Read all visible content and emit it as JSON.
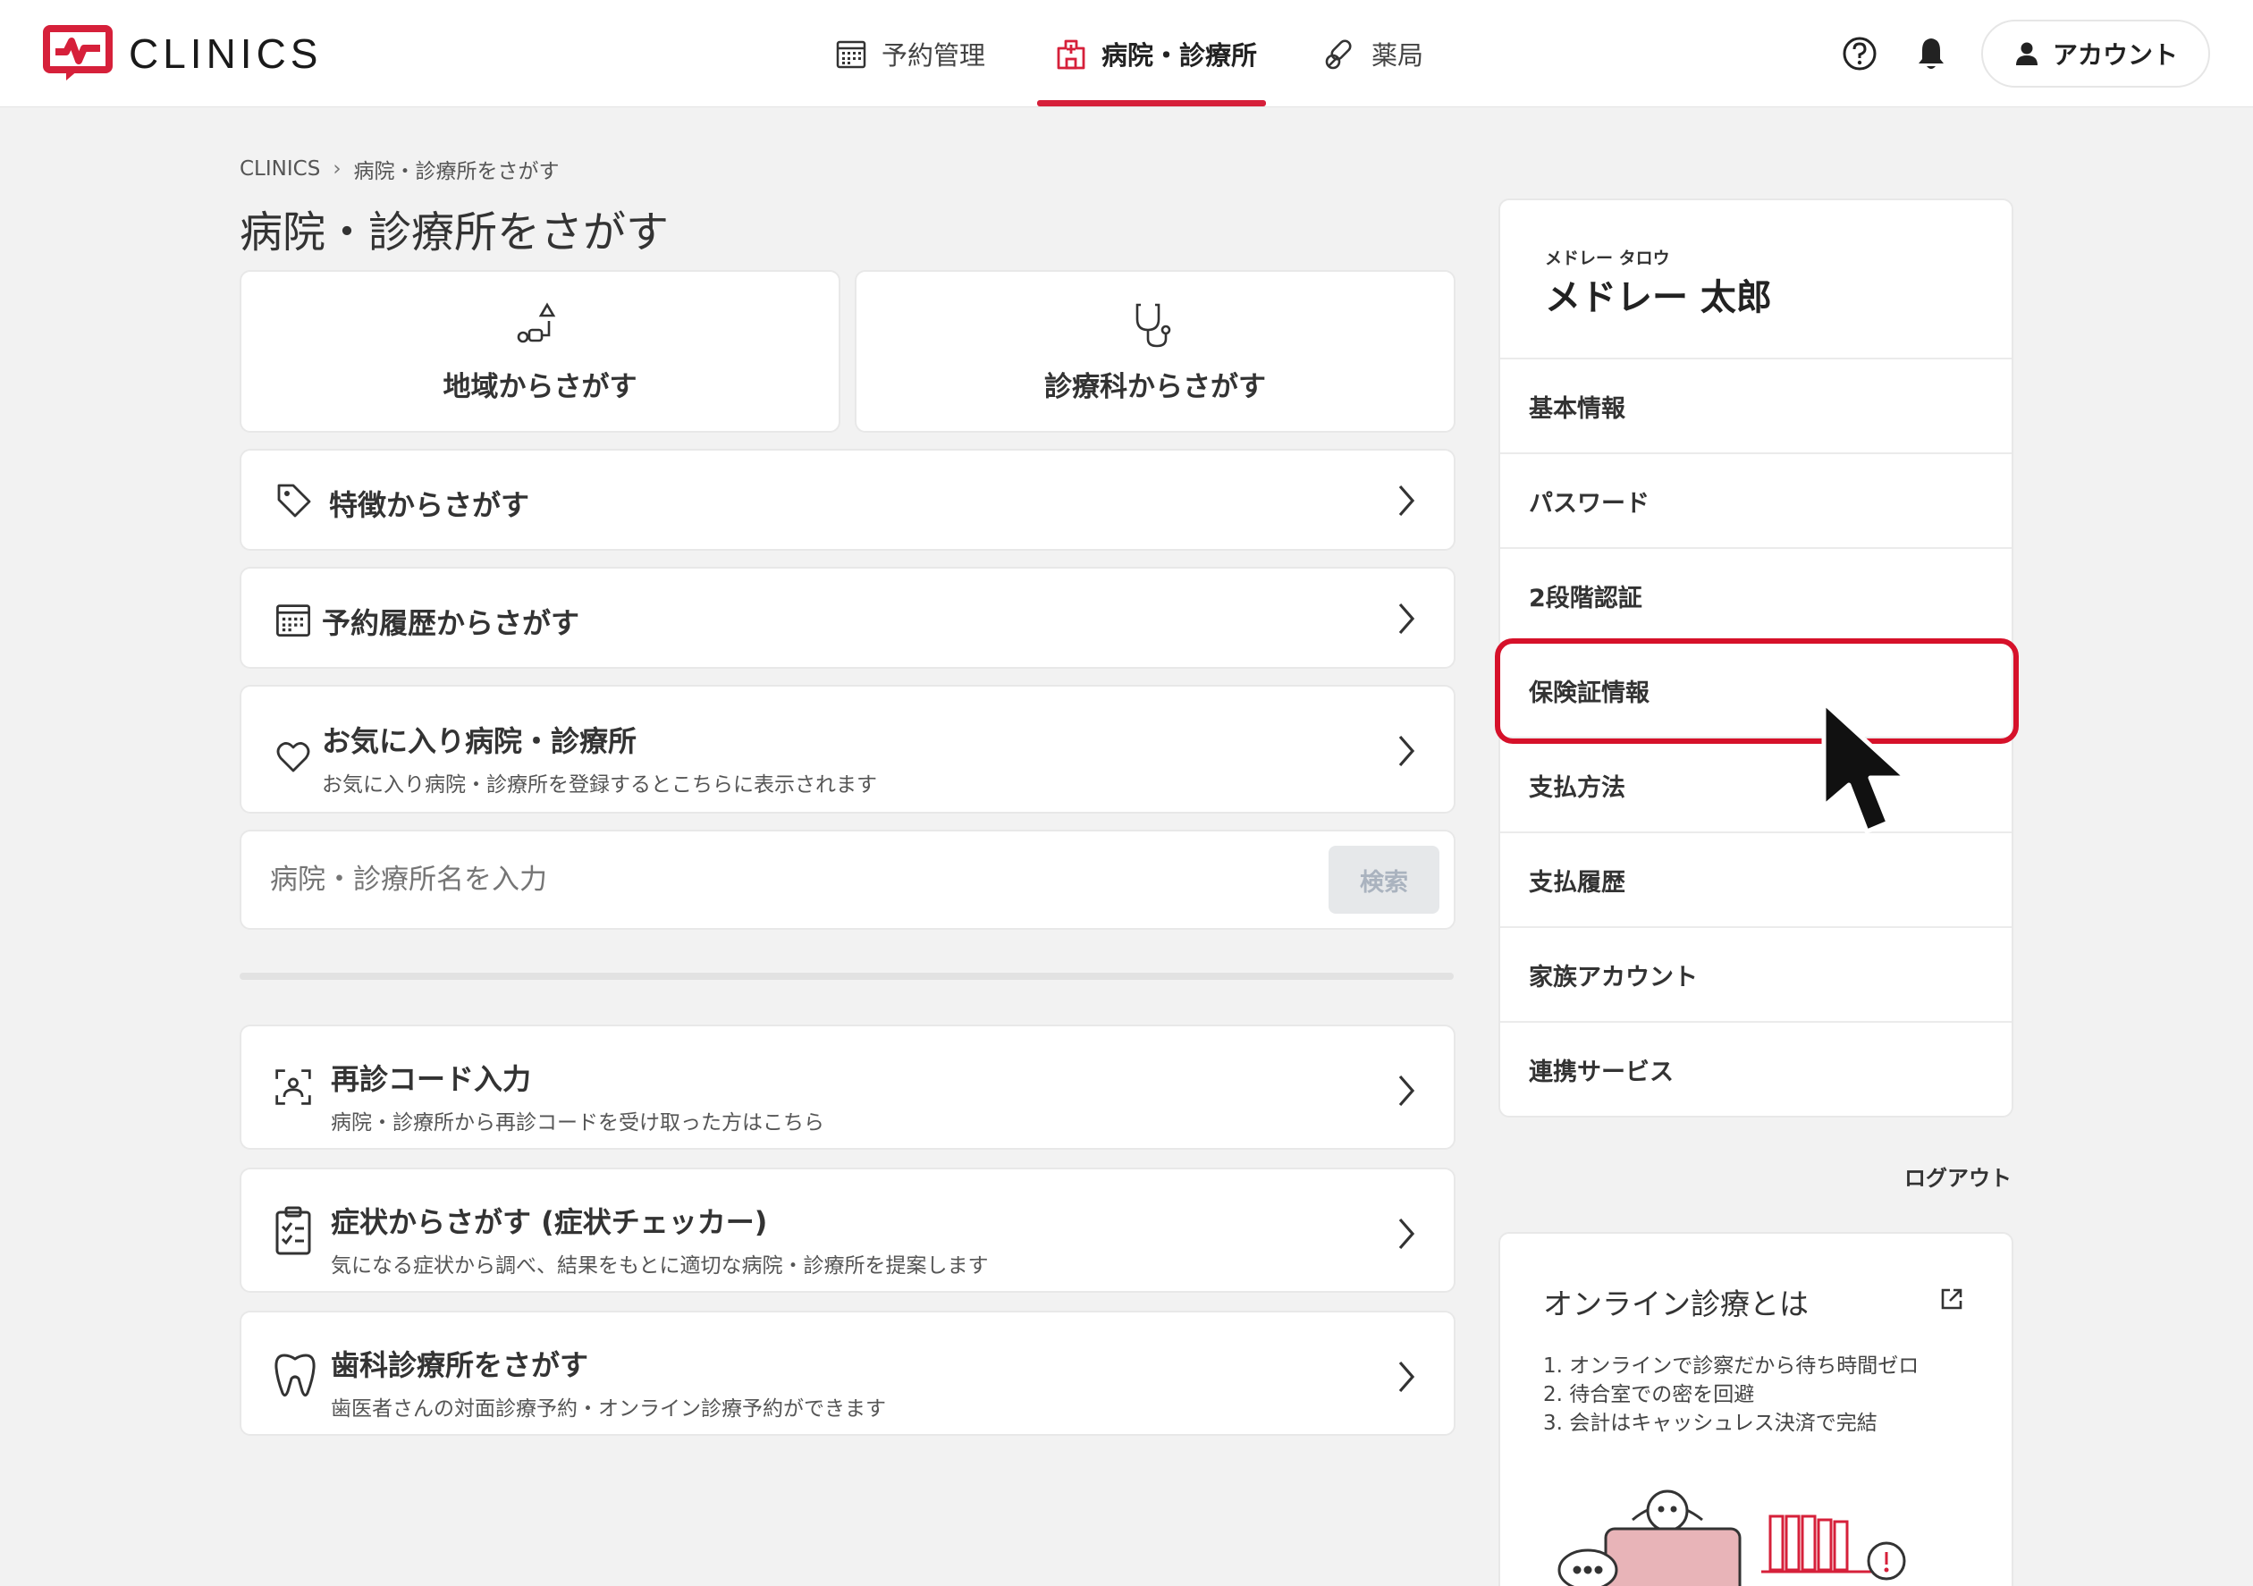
{
  "header": {
    "logo_text": "CLINICS",
    "nav": [
      {
        "label": "予約管理",
        "icon": "calendar-icon",
        "active": false
      },
      {
        "label": "病院・診療所",
        "icon": "hospital-icon",
        "active": true
      },
      {
        "label": "薬局",
        "icon": "pill-icon",
        "active": false
      }
    ],
    "account_label": "アカウント"
  },
  "breadcrumb": {
    "root": "CLINICS",
    "current": "病院・診療所をさがす"
  },
  "page_title": "病院・診療所をさがす",
  "search_cards": [
    {
      "label": "地域からさがす",
      "icon": "map-pin-icon"
    },
    {
      "label": "診療科からさがす",
      "icon": "stethoscope-icon"
    }
  ],
  "rows": {
    "features": {
      "title": "特徴からさがす",
      "icon": "tag-icon"
    },
    "history": {
      "title": "予約履歴からさがす",
      "icon": "calendar-icon"
    },
    "favorites": {
      "title": "お気に入り病院・診療所",
      "sub": "お気に入り病院・診療所を登録するとこちらに表示されます",
      "icon": "heart-icon"
    }
  },
  "search": {
    "placeholder": "病院・診療所名を入力",
    "button": "検索"
  },
  "lower_rows": {
    "revisit": {
      "title": "再診コード入力",
      "sub": "病院・診療所から再診コードを受け取った方はこちら",
      "icon": "scan-person-icon"
    },
    "symptoms": {
      "title": "症状からさがす (症状チェッカー)",
      "sub": "気になる症状から調べ、結果をもとに適切な病院・診療所を提案します",
      "icon": "clipboard-check-icon"
    },
    "dental": {
      "title": "歯科診療所をさがす",
      "sub": "歯医者さんの対面診療予約・オンライン診療予約ができます",
      "icon": "tooth-icon"
    }
  },
  "account_panel": {
    "kana": "メドレー タロウ",
    "name": "メドレー 太郎",
    "menu": [
      "基本情報",
      "パスワード",
      "2段階認証",
      "保険証情報",
      "支払方法",
      "支払履歴",
      "家族アカウント",
      "連携サービス"
    ],
    "highlighted": "保険証情報"
  },
  "logout": "ログアウト",
  "online_info": {
    "title": "オンライン診療とは",
    "items": [
      "1. オンラインで診察だから待ち時間ゼロ",
      "2. 待合室での密を回避",
      "3. 会計はキャッシュレス決済で完結"
    ]
  },
  "colors": {
    "accent": "#d6203a",
    "highlight": "#d6112a",
    "bg": "#f2f2f2"
  }
}
